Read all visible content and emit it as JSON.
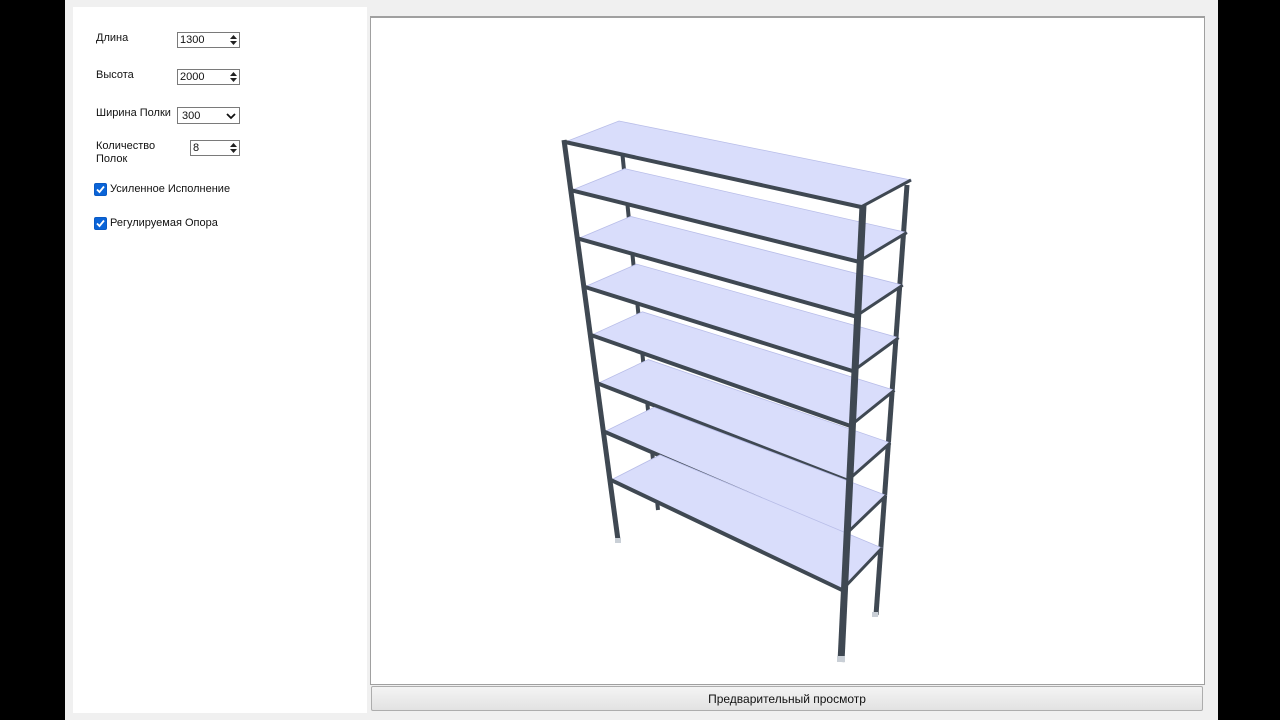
{
  "form": {
    "length_label": "Длина",
    "length_value": "1300",
    "height_label": "Высота",
    "height_value": "2000",
    "shelf_width_label": "Ширина Полки",
    "shelf_width_value": "300",
    "shelf_count_label_line1": "Количество",
    "shelf_count_label_line2": "Полок",
    "shelf_count_value": "8",
    "reinforced_label": "Усиленное Исполнение",
    "reinforced_checked": true,
    "adjustable_label": "Регулируемая Опора",
    "adjustable_checked": true
  },
  "preview": {
    "button_label": "Предварительный просмотр",
    "shelves": 8
  },
  "colors": {
    "accent": "#0a64d8",
    "shelf": "#d9ddfb",
    "frame": "#3f4852"
  }
}
